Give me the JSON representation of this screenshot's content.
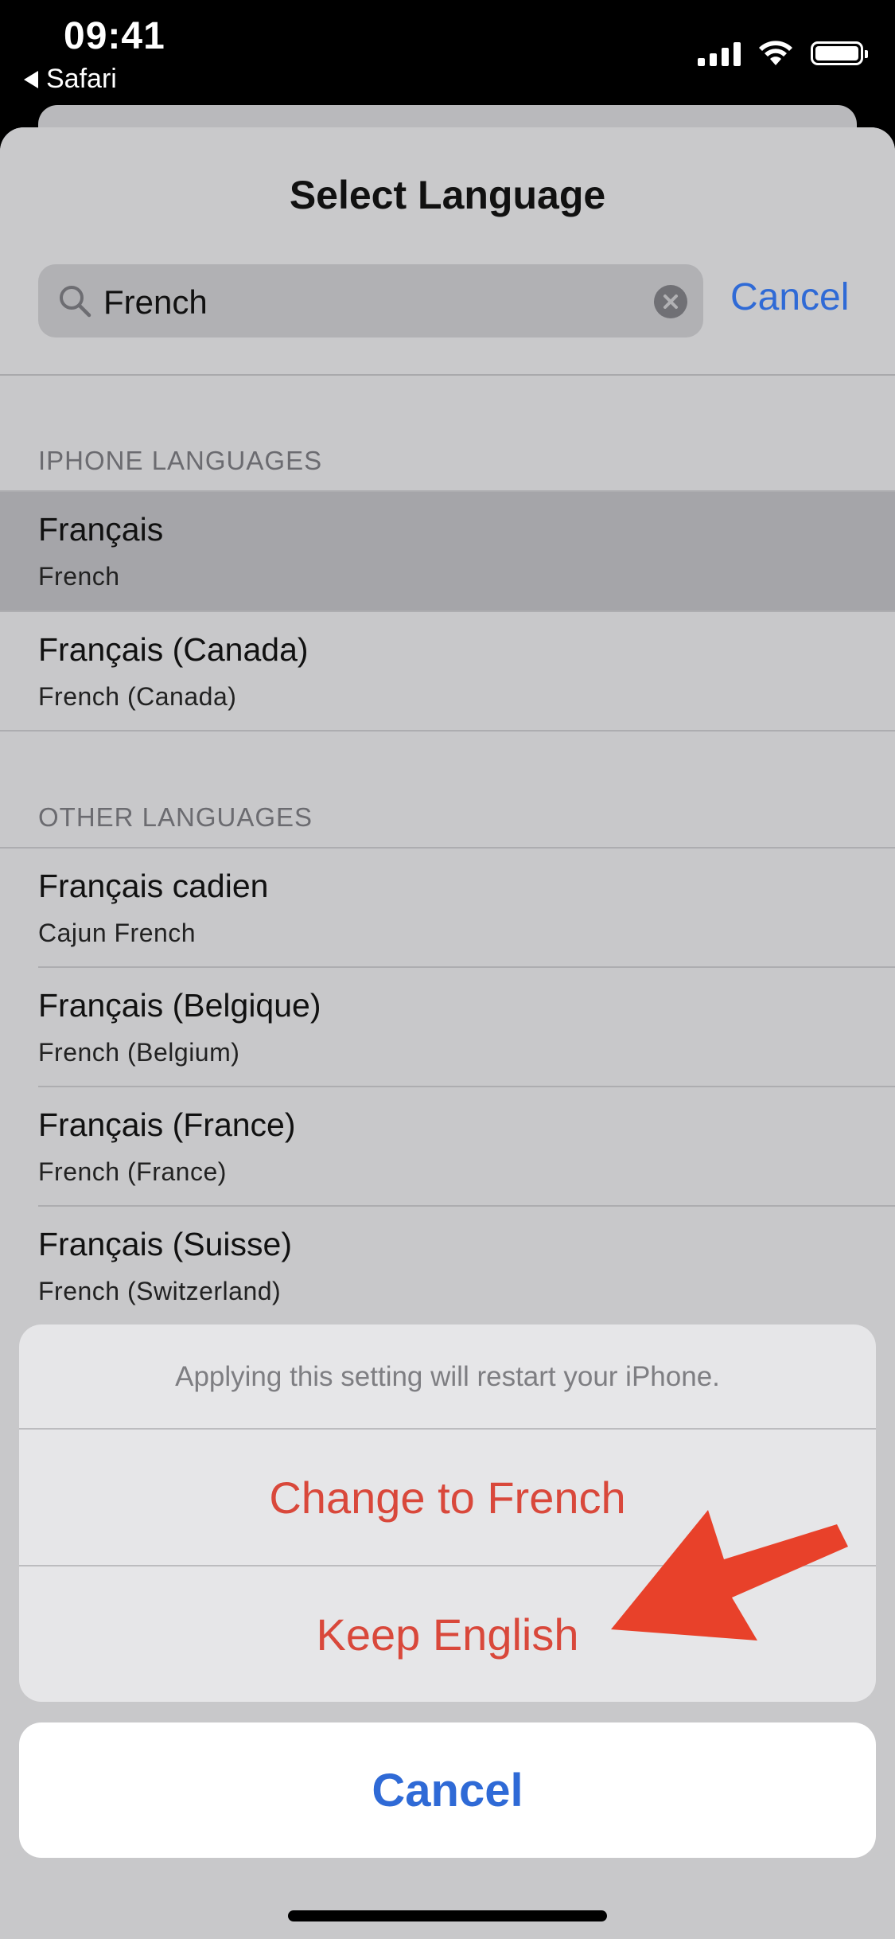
{
  "status_bar": {
    "time": "09:41",
    "back_label": "Safari"
  },
  "sheet": {
    "title": "Select Language",
    "search": {
      "value": "French",
      "cancel_label": "Cancel"
    },
    "sections": [
      {
        "label": "IPHONE LANGUAGES",
        "items": [
          {
            "name": "Français",
            "subtitle": "French",
            "selected": true
          },
          {
            "name": "Français (Canada)",
            "subtitle": "French (Canada)",
            "selected": false
          }
        ]
      },
      {
        "label": "OTHER LANGUAGES",
        "items": [
          {
            "name": "Français cadien",
            "subtitle": "Cajun French"
          },
          {
            "name": "Français (Belgique)",
            "subtitle": "French (Belgium)"
          },
          {
            "name": "Français (France)",
            "subtitle": "French (France)"
          },
          {
            "name": "Français (Suisse)",
            "subtitle": "French (Switzerland)"
          }
        ]
      }
    ]
  },
  "action_sheet": {
    "message": "Applying this setting will restart your iPhone.",
    "change_label": "Change to French",
    "keep_label": "Keep English",
    "cancel_label": "Cancel"
  },
  "colors": {
    "accent_blue": "#2f6ad6",
    "destructive_red": "#d9483b",
    "arrow_red": "#e8412a"
  },
  "icons": [
    "search-icon",
    "clear-icon",
    "back-arrow-icon",
    "cellular-signal-icon",
    "wifi-icon",
    "battery-icon",
    "annotation-arrow-icon"
  ]
}
